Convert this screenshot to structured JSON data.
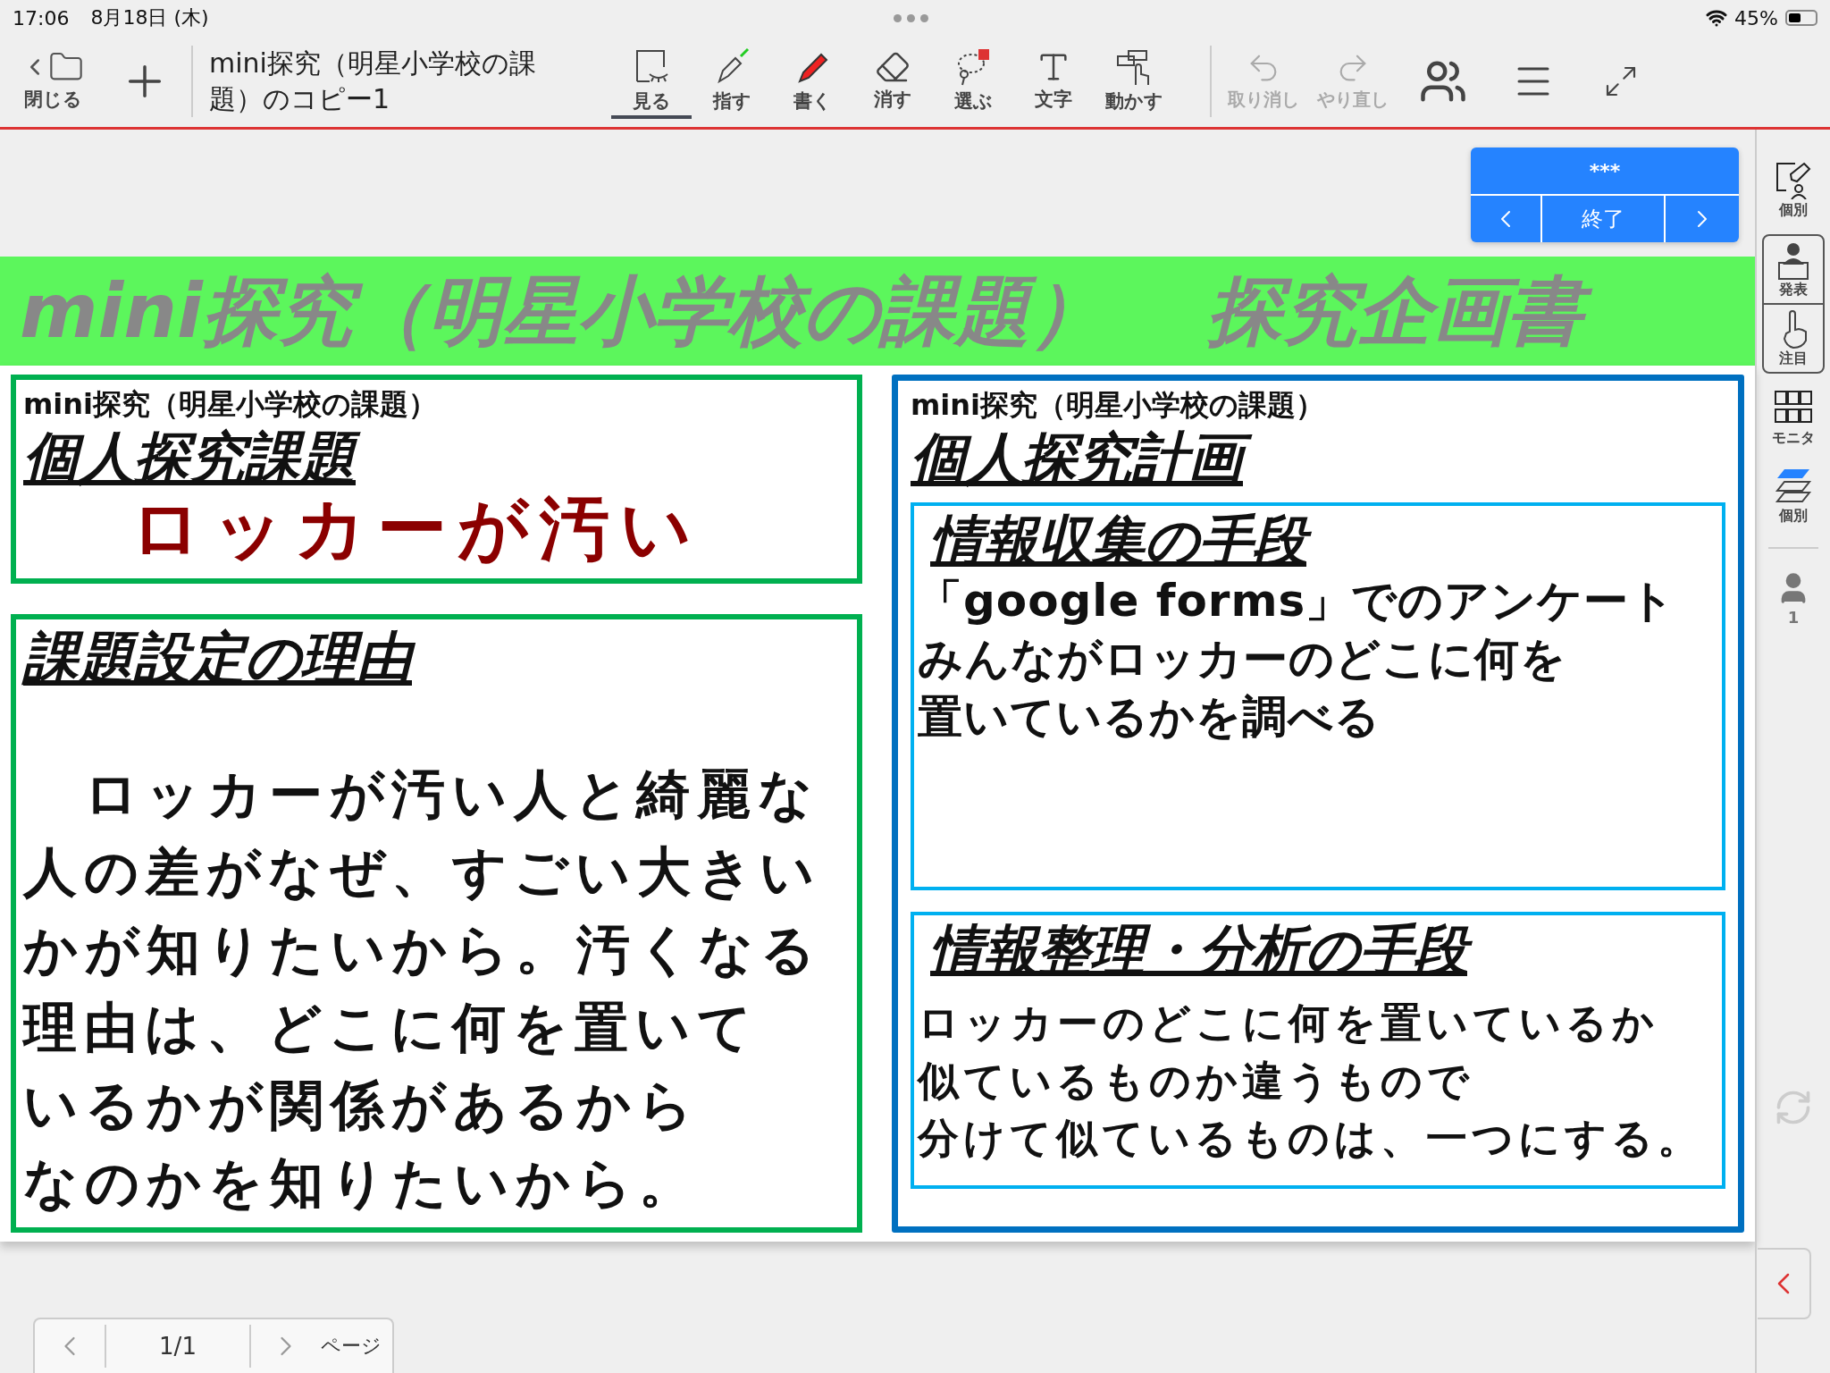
{
  "status_bar": {
    "time": "17:06",
    "date": "8月18日 (木)",
    "battery": "45%"
  },
  "toolbar": {
    "close_label": "閉じる",
    "document_title": "mini探究（明星小学校の課題）のコピー1",
    "tools": [
      {
        "label": "見る",
        "selected": true
      },
      {
        "label": "指す",
        "selected": false
      },
      {
        "label": "書く",
        "selected": false
      },
      {
        "label": "消す",
        "selected": false
      },
      {
        "label": "選ぶ",
        "selected": false
      },
      {
        "label": "文字",
        "selected": false
      },
      {
        "label": "動かす",
        "selected": false
      }
    ],
    "history": [
      {
        "kind": "undo",
        "label": "取り消し",
        "disabled": true
      },
      {
        "kind": "redo",
        "label": "やり直し",
        "disabled": true
      }
    ]
  },
  "presenter_panel": {
    "title": "***",
    "end_label": "終了"
  },
  "banner": {
    "title": "mini探究（明星小学校の課題）",
    "subtitle": "探究企画書"
  },
  "left_cards": [
    {
      "caption": "mini探究（明星小学校の課題）",
      "heading": "個人探究課題",
      "lines": [
        "ロッカーが汚い"
      ]
    },
    {
      "heading": "課題設定の理由",
      "lines": [
        "　ロッカーが汚い人と綺麗な",
        "人の差がなぜ、すごい大きい",
        "かが知りたいから。汚くなる",
        "理由は、どこに何を置いて",
        "いるかが関係があるから",
        "なのかを知りたいから。"
      ]
    }
  ],
  "right_card": {
    "caption": "mini探究（明星小学校の課題）",
    "heading": "個人探究計画",
    "sections": [
      {
        "heading": "情報収集の手段",
        "lines": [
          "「google forms」でのアンケート",
          "みんながロッカーのどこに何を",
          "置いているかを調べる"
        ]
      },
      {
        "heading": "情報整理・分析の手段",
        "lines": [
          "ロッカーのどこに何を置いているか",
          "似ているものか違うもので",
          "分けて似ているものは、一つにする。"
        ]
      }
    ]
  },
  "sidebar": {
    "items": [
      {
        "kind": "plain",
        "label": "個別"
      },
      {
        "kind": "grouped",
        "label": "発表"
      },
      {
        "kind": "grouped",
        "label": "注目"
      },
      {
        "kind": "plain",
        "label": "モニタ"
      },
      {
        "kind": "plain",
        "label": "個別"
      }
    ],
    "user_count": "1"
  },
  "page_nav": {
    "page": "1/1",
    "label": "ページ"
  }
}
